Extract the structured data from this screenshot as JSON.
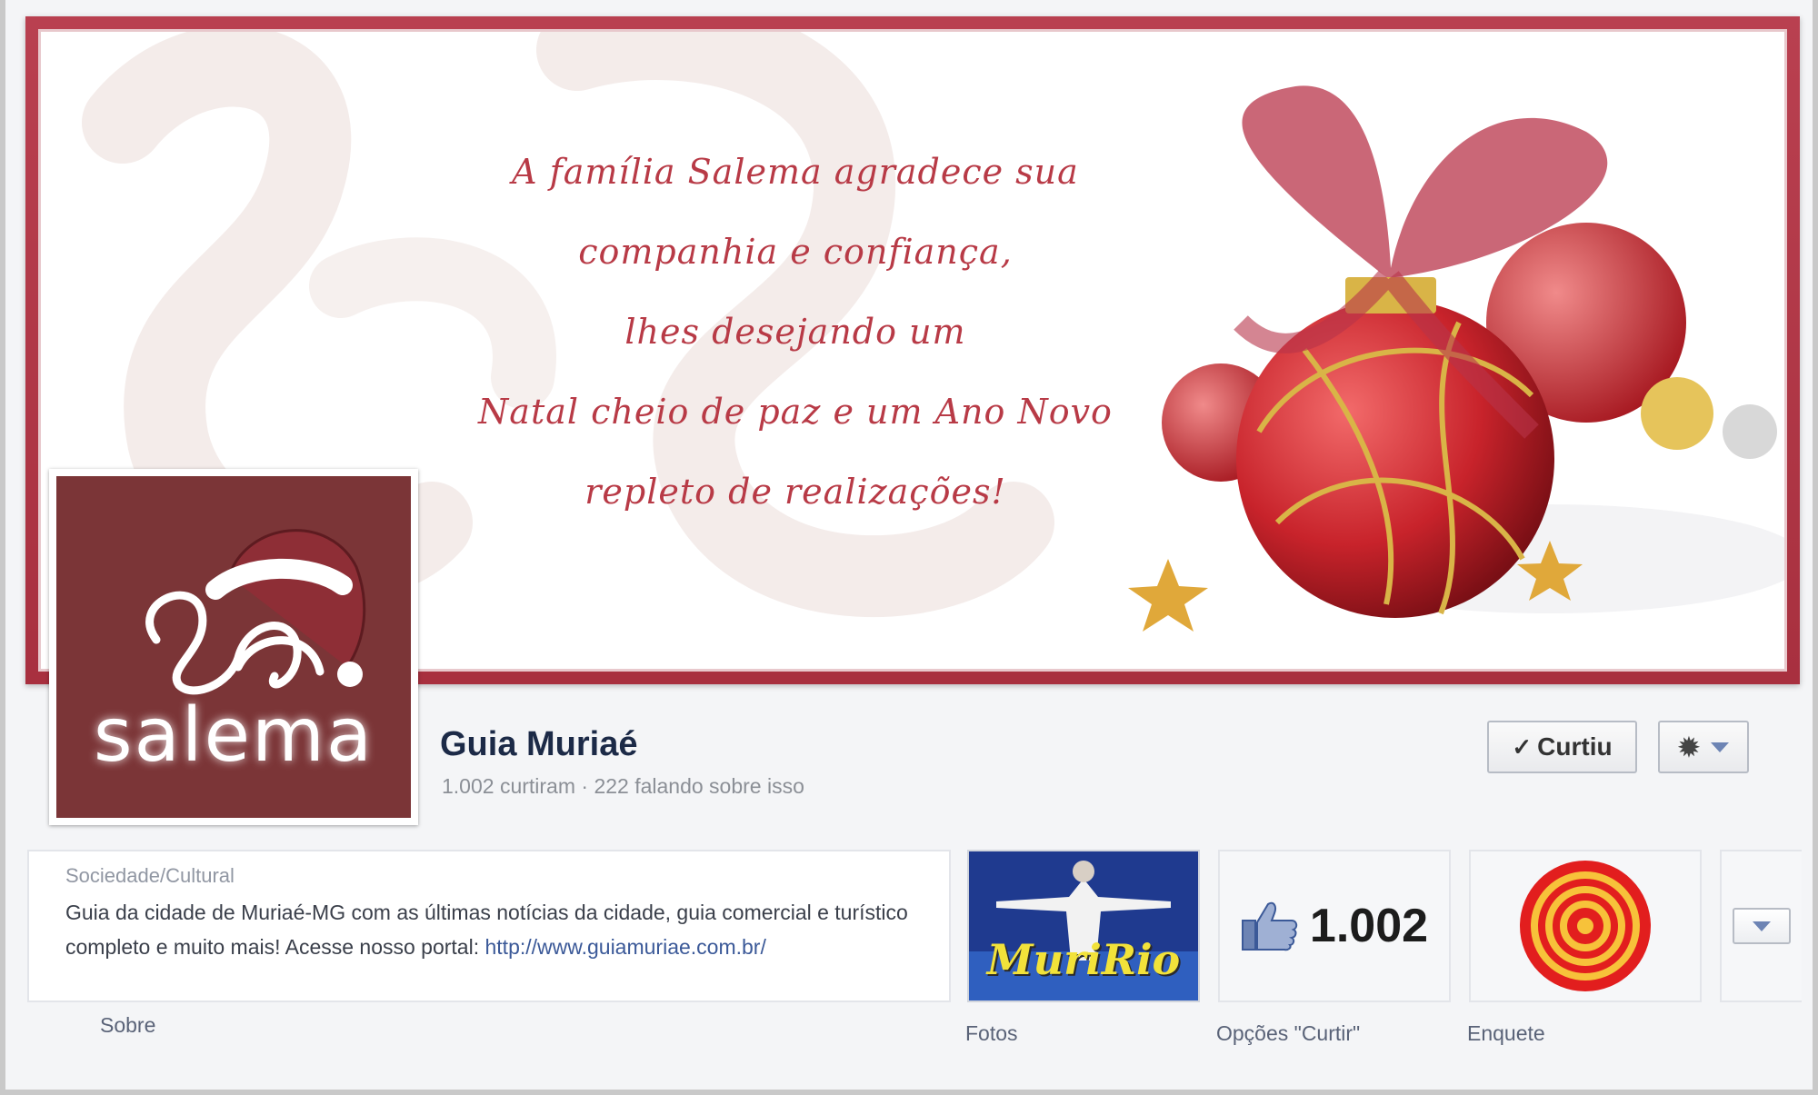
{
  "cover": {
    "greeting_lines": [
      "A família Salema agradece sua",
      "companhia e confiança,",
      "lhes desejando um",
      "Natal cheio de paz e um Ano Novo",
      "repleto de realizações!"
    ]
  },
  "profile": {
    "brand_name": "salema"
  },
  "page": {
    "title": "Guia Muriaé",
    "stats": "1.002 curtiram · 222 falando sobre isso"
  },
  "actions": {
    "liked_label": "Curtiu",
    "check_icon": "check-icon",
    "gear_icon": "gear-icon"
  },
  "about": {
    "category": "Sociedade/Cultural",
    "description": "Guia da cidade de Muriaé-MG com as últimas notícias da cidade, guia comercial e turístico completo e muito mais! Acesse nosso portal: ",
    "link": "http://www.guiamuriae.com.br/",
    "tab_label": "Sobre"
  },
  "apps": {
    "photos": {
      "label": "Fotos",
      "image_text": "MuriRio"
    },
    "likes": {
      "label": "Opções \"Curtir\"",
      "count": "1.002"
    },
    "poll": {
      "label": "Enquete"
    }
  },
  "colors": {
    "cover_frame": "#b94050",
    "greeting_text": "#b83a46",
    "profile_bg": "#7b3537",
    "title": "#1c2a47",
    "link": "#3b5998"
  }
}
